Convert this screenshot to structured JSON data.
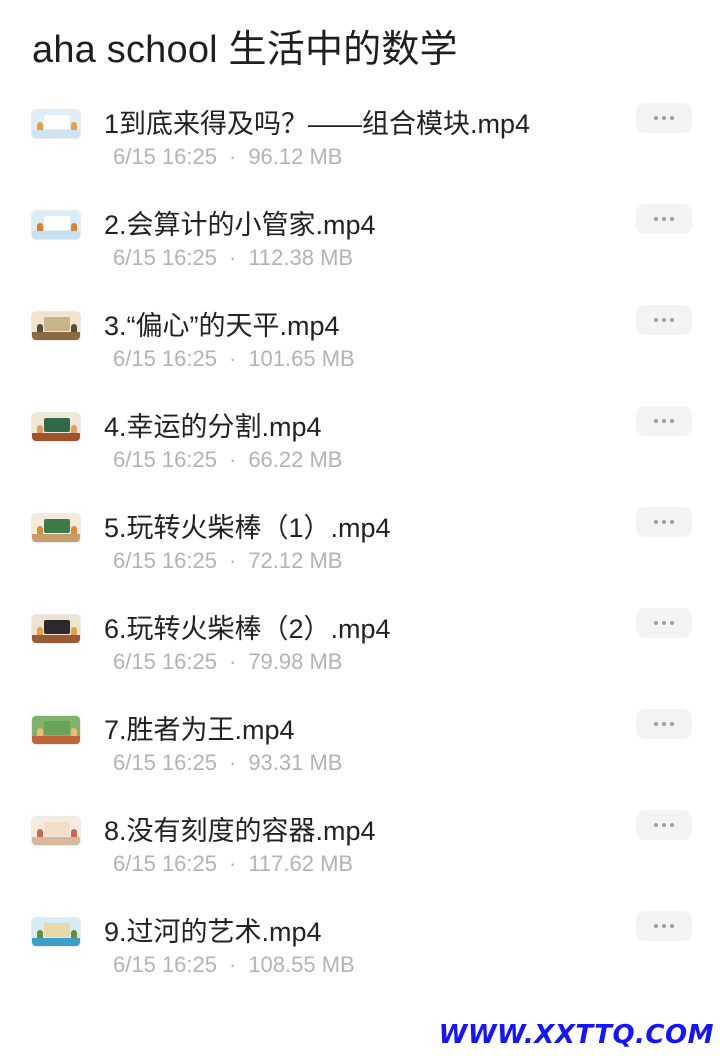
{
  "header": {
    "title": "aha school 生活中的数学"
  },
  "files": [
    {
      "name": "1到底来得及吗？——组合模块.mp4",
      "date": "6/15 16:25",
      "size": "96.12 MB",
      "thumb": {
        "bg": "#dfeef8",
        "ground": "#cfe3f0",
        "board": "#ffffff",
        "fig": "#e6a23c"
      }
    },
    {
      "name": "2.会算计的小管家.mp4",
      "date": "6/15 16:25",
      "size": "112.38 MB",
      "thumb": {
        "bg": "#d9ecf7",
        "ground": "#c5e0f0",
        "board": "#ffffff",
        "fig": "#d9822b"
      }
    },
    {
      "name": "3.“偏心”的天平.mp4",
      "date": "6/15 16:25",
      "size": "101.65 MB",
      "thumb": {
        "bg": "#efe4cf",
        "ground": "#8a6a3f",
        "board": "#c9b48a",
        "fig": "#5a4a3a"
      }
    },
    {
      "name": "4.幸运的分割.mp4",
      "date": "6/15 16:25",
      "size": "66.22 MB",
      "thumb": {
        "bg": "#f1e7d4",
        "ground": "#a0522d",
        "board": "#2f6b45",
        "fig": "#e0a060"
      }
    },
    {
      "name": "5.玩转火柴棒（1）.mp4",
      "date": "6/15 16:25",
      "size": "72.12 MB",
      "thumb": {
        "bg": "#f3ead9",
        "ground": "#c89b6a",
        "board": "#3c7a4c",
        "fig": "#d98c3a"
      }
    },
    {
      "name": "6.玩转火柴棒（2）.mp4",
      "date": "6/15 16:25",
      "size": "79.98 MB",
      "thumb": {
        "bg": "#efe2cf",
        "ground": "#9a5b32",
        "board": "#2a2a2a",
        "fig": "#e2a04a"
      }
    },
    {
      "name": "7.胜者为王.mp4",
      "date": "6/15 16:25",
      "size": "93.31 MB",
      "thumb": {
        "bg": "#7fb36a",
        "ground": "#c0643a",
        "board": "#6aa25a",
        "fig": "#e8c070"
      }
    },
    {
      "name": "8.没有刻度的容器.mp4",
      "date": "6/15 16:25",
      "size": "117.62 MB",
      "thumb": {
        "bg": "#f7ebe0",
        "ground": "#d8b89a",
        "board": "#f2dccb",
        "fig": "#c86a4a"
      }
    },
    {
      "name": "9.过河的艺术.mp4",
      "date": "6/15 16:25",
      "size": "108.55 MB",
      "thumb": {
        "bg": "#d5ecf5",
        "ground": "#3aa0c8",
        "board": "#e8d7a8",
        "fig": "#6a8a3a"
      }
    }
  ],
  "meta_separator": "·",
  "watermark": {
    "text": "WWW.XXTTQ.COM",
    "color": "#1414ff"
  }
}
